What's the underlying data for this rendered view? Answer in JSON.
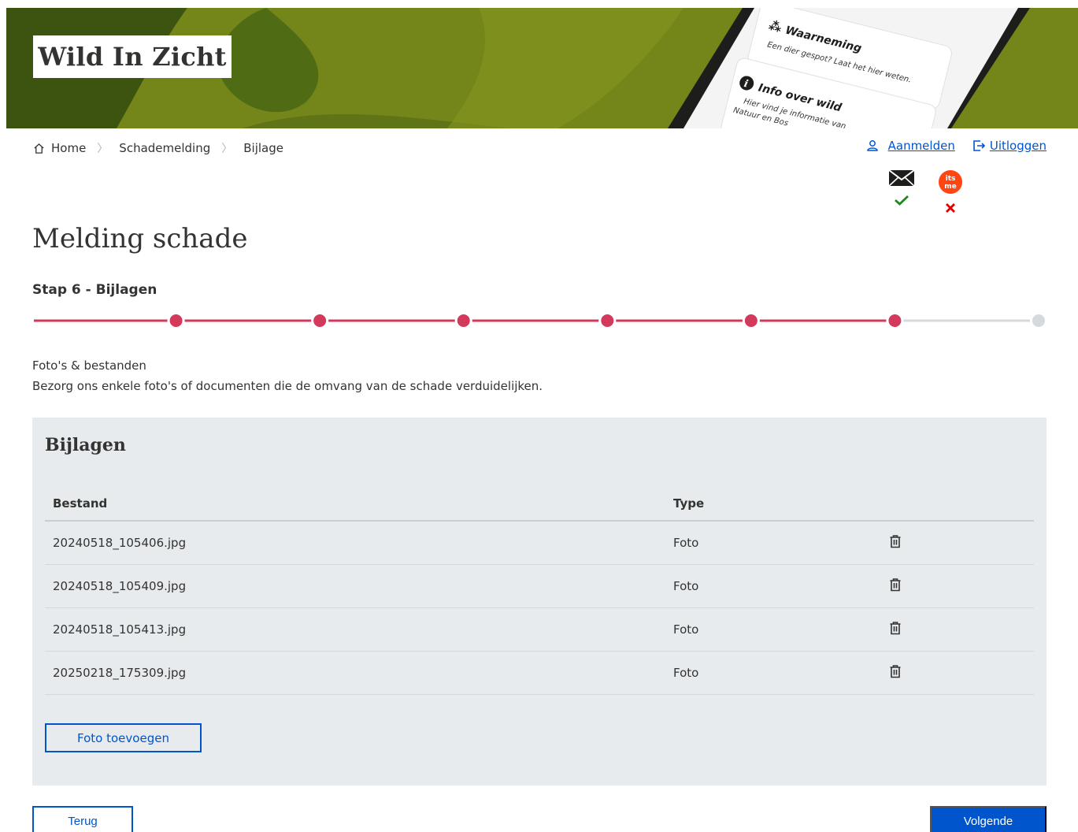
{
  "header": {
    "logo_text": "Wild In Zicht",
    "phone_card_1": {
      "title": "Waarneming",
      "subtitle": "Een dier gespot? Laat het hier weten."
    },
    "phone_card_2": {
      "title": "Info over wild",
      "line1": "Hier vind je informatie van",
      "line2": "Natuur en Bos"
    }
  },
  "breadcrumb": {
    "items": [
      "Home",
      "Schademelding",
      "Bijlage"
    ]
  },
  "auth": {
    "login_label": "Aanmelden",
    "logout_label": "Uitloggen"
  },
  "providers": [
    {
      "name": "email",
      "icon": "envelope-icon",
      "status": "verified",
      "status_color": "#1a8a1a"
    },
    {
      "name": "itsme",
      "icon": "itsme-icon",
      "logo_text": "its me",
      "status": "not-verified",
      "status_color": "#e00000"
    }
  ],
  "page": {
    "title": "Melding schade",
    "step_title": "Stap 6 - Bijlagen"
  },
  "stepper": {
    "total_steps": 7,
    "completed_steps": 6,
    "active_color": "#d2395a",
    "inactive_color": "#d4d9de"
  },
  "intro": {
    "line1": "Foto's & bestanden",
    "line2": "Bezorg ons enkele foto's of documenten die de omvang van de schade verduidelijken."
  },
  "attachments": {
    "heading": "Bijlagen",
    "columns": [
      "Bestand",
      "Type"
    ],
    "rows": [
      {
        "file": "20240518_105406.jpg",
        "type": "Foto"
      },
      {
        "file": "20240518_105409.jpg",
        "type": "Foto"
      },
      {
        "file": "20240518_105413.jpg",
        "type": "Foto"
      },
      {
        "file": "20250218_175309.jpg",
        "type": "Foto"
      }
    ],
    "add_button": "Foto toevoegen"
  },
  "footer": {
    "back_button": "Terug",
    "next_button": "Volgende"
  },
  "colors": {
    "brand_green_dark": "#3d5410",
    "brand_green_light": "#7a8a1a",
    "primary_blue": "#0055cc"
  }
}
